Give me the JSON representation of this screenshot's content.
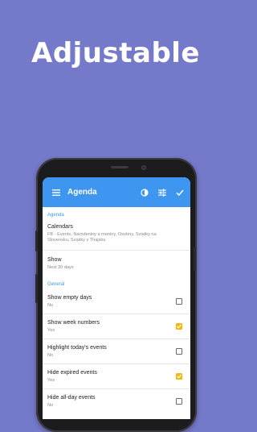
{
  "headline": "Adjustable",
  "appbar": {
    "title": "Agenda",
    "icons": [
      "menu-icon",
      "theme-contrast-icon",
      "tune-icon",
      "check-icon"
    ]
  },
  "sections": {
    "agenda_header": "Agenda",
    "general_header": "General"
  },
  "items": {
    "calendars": {
      "title": "Calendars",
      "subtitle": "FB - Events, Narodeniny a meniny, Osobny, Sviatky na Slovensku, Sviatky v Thajsku"
    },
    "show": {
      "title": "Show",
      "subtitle": "Next 30 days"
    },
    "show_empty_days": {
      "title": "Show empty days",
      "subtitle": "No",
      "checked": false
    },
    "show_week_numbers": {
      "title": "Show week numbers",
      "subtitle": "Yes",
      "checked": true
    },
    "highlight_today": {
      "title": "Highlight today's events",
      "subtitle": "No",
      "checked": false
    },
    "hide_expired": {
      "title": "Hide expired events",
      "subtitle": "Yes",
      "checked": true
    },
    "hide_all_day": {
      "title": "Hide all-day events",
      "subtitle": "No",
      "checked": false
    }
  },
  "colors": {
    "background": "#7579c9",
    "appbar": "#3f96f0",
    "accent": "#3f96f0",
    "checkbox_checked": "#f4b90f"
  }
}
